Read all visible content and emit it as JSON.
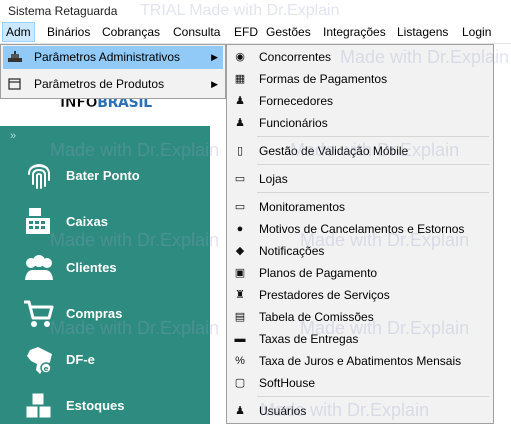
{
  "window": {
    "title": "Sistema Retaguarda"
  },
  "menubar": {
    "items": [
      {
        "label": "Adm",
        "active": true
      },
      {
        "label": "Binários"
      },
      {
        "label": "Cobranças"
      },
      {
        "label": "Consulta"
      },
      {
        "label": "EFD"
      },
      {
        "label": "Gestões"
      },
      {
        "label": "Integrações"
      },
      {
        "label": "Listagens"
      },
      {
        "label": "Login"
      }
    ]
  },
  "logo": {
    "part1": "INFO",
    "part2": "BRASIL"
  },
  "sidebar": {
    "items": [
      {
        "label": "Bater Ponto",
        "icon": "fingerprint-icon"
      },
      {
        "label": "Caixas",
        "icon": "cash-register-icon"
      },
      {
        "label": "Clientes",
        "icon": "users-icon"
      },
      {
        "label": "Compras",
        "icon": "shopping-cart-icon"
      },
      {
        "label": "DF-e",
        "icon": "brazil-map-icon"
      },
      {
        "label": "Estoques",
        "icon": "boxes-icon"
      }
    ],
    "collapse_glyph": "»"
  },
  "submenu_adm": {
    "items": [
      {
        "label": "Parâmetros Administrativos",
        "highlighted": true,
        "arrow": "▶"
      },
      {
        "label": "Parâmetros de Produtos",
        "arrow": "▶"
      }
    ]
  },
  "submenu_params": {
    "items": [
      {
        "label": "Concorrentes",
        "icon": "target-icon"
      },
      {
        "label": "Formas de Pagamentos",
        "icon": "payment-icon"
      },
      {
        "label": "Fornecedores",
        "icon": "supplier-icon"
      },
      {
        "label": "Funcionários",
        "icon": "person-icon"
      },
      {
        "label": "Gestão de Validação Móbile",
        "icon": "mobile-icon"
      },
      {
        "label": "Lojas",
        "icon": "store-icon"
      },
      {
        "label": "Monitoramentos",
        "icon": "monitor-icon"
      },
      {
        "label": "Motivos de Cancelamentos e Estornos",
        "icon": "cancel-icon"
      },
      {
        "label": "Notificações",
        "icon": "bell-icon"
      },
      {
        "label": "Planos de Pagamento",
        "icon": "pay-plan-icon"
      },
      {
        "label": "Prestadores de Serviços",
        "icon": "service-provider-icon"
      },
      {
        "label": "Tabela de Comissões",
        "icon": "table-icon"
      },
      {
        "label": "Taxas de Entregas",
        "icon": "delivery-icon"
      },
      {
        "label": "Taxa de Juros e Abatimentos Mensais",
        "icon": "percent-icon"
      },
      {
        "label": "SoftHouse",
        "icon": "softhouse-icon"
      },
      {
        "label": "Usuários",
        "icon": "user-icon"
      }
    ]
  },
  "watermark": {
    "text": "Made with Dr.Explain",
    "trial": "TRIAL"
  }
}
